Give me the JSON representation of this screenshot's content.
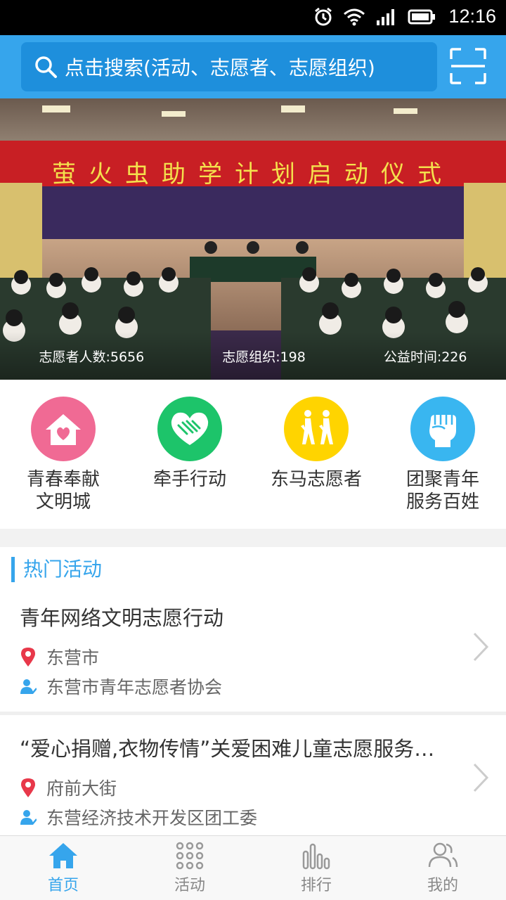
{
  "status_bar": {
    "time": "12:16"
  },
  "search": {
    "placeholder": "点击搜索(活动、志愿者、志愿组织)"
  },
  "banner": {
    "banner_text": "萤火虫助学计划启动仪式",
    "stats": [
      {
        "label": "志愿者人数:5656"
      },
      {
        "label": "志愿组织:198"
      },
      {
        "label": "公益时间:226"
      }
    ]
  },
  "categories": [
    {
      "label": "青春奉献\n文明城",
      "icon": "house-heart-icon",
      "color": "#f06a94"
    },
    {
      "label": "牵手行动",
      "icon": "handshake-heart-icon",
      "color": "#1dc46a"
    },
    {
      "label": "东马志愿者",
      "icon": "runners-icon",
      "color": "#ffd400"
    },
    {
      "label": "团聚青年\n服务百姓",
      "icon": "fist-icon",
      "color": "#39b6f0"
    }
  ],
  "hot": {
    "title": "热门活动",
    "items": [
      {
        "title": "青年网络文明志愿行动",
        "location": "东营市",
        "org": "东营市青年志愿者协会"
      },
      {
        "title": "“爱心捐赠,衣物传情”关爱困难儿童志愿服务…",
        "location": "府前大街",
        "org": "东营经济技术开发区团工委"
      }
    ]
  },
  "tabs": [
    {
      "label": "首页",
      "icon": "home-icon",
      "active": true
    },
    {
      "label": "活动",
      "icon": "grid-icon",
      "active": false
    },
    {
      "label": "排行",
      "icon": "bar-chart-icon",
      "active": false
    },
    {
      "label": "我的",
      "icon": "user-icon",
      "active": false
    }
  ],
  "colors": {
    "accent": "#36a5ec",
    "header": "#36a5ec"
  }
}
